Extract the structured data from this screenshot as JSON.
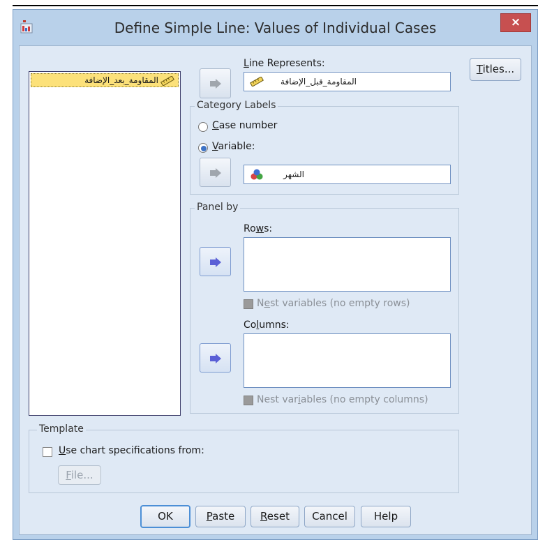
{
  "window": {
    "title": "Define Simple Line: Values of Individual Cases",
    "close_glyph": "×"
  },
  "variables_list": {
    "items": [
      "المقاومة_بعد_الإضافة"
    ]
  },
  "line_represents": {
    "label_key": "L",
    "label_rest": "ine Represents:",
    "value": "المقاومة_قبل_الإضافة"
  },
  "category_labels": {
    "group_label": "Category Labels",
    "case_number_key": "C",
    "case_number_rest": "ase number",
    "variable_key": "V",
    "variable_rest": "ariable:",
    "selected": "variable",
    "variable_value": "الشهر"
  },
  "panel_by": {
    "group_label": "Panel by",
    "rows_pre": "Ro",
    "rows_key": "w",
    "rows_post": "s:",
    "nest_rows_pre": "N",
    "nest_rows_key": "e",
    "nest_rows_post": "st variables (no empty rows)",
    "columns_pre": "Co",
    "columns_key": "l",
    "columns_post": "umns:",
    "nest_cols_pre": "Nest var",
    "nest_cols_key": "i",
    "nest_cols_post": "ables (no empty columns)"
  },
  "template": {
    "group_label": "Template",
    "use_spec_key": "U",
    "use_spec_rest": "se chart specifications from:",
    "file_key": "F",
    "file_rest": "ile..."
  },
  "buttons": {
    "titles_key": "T",
    "titles_rest": "itles...",
    "ok": "OK",
    "paste_key": "P",
    "paste_rest": "aste",
    "reset_key": "R",
    "reset_rest": "eset",
    "cancel": "Cancel",
    "help": "Help"
  },
  "icons": {
    "app": "spss-chart-icon",
    "scale_variable": "ruler-scale-icon",
    "nominal_variable": "nominal-balls-icon",
    "move_arrow": "arrow-right-icon"
  },
  "colors": {
    "selected_item_bg": "#fce17a",
    "close_button": "#c75050",
    "arrow_active": "#5a5fd6",
    "arrow_inactive": "#a0a6ad"
  }
}
